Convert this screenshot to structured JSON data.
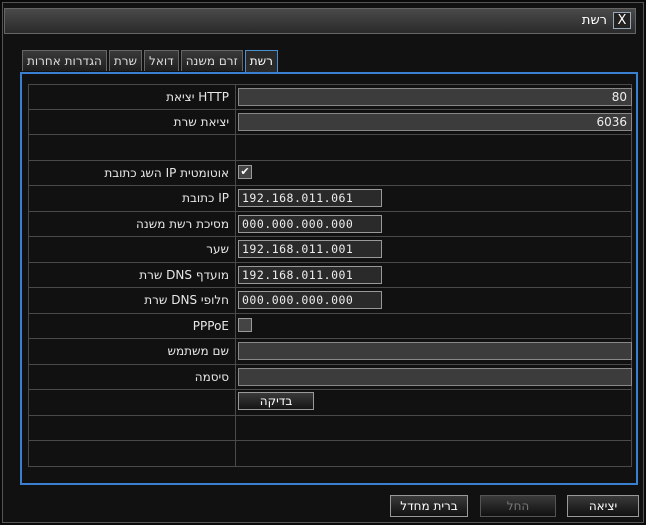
{
  "window": {
    "title": "רשת",
    "close_label": "X"
  },
  "tabs": [
    {
      "label": "רשת",
      "active": true
    },
    {
      "label": "זרם משנה"
    },
    {
      "label": "דואל"
    },
    {
      "label": "שרת"
    },
    {
      "label": "הגדרות אחרות"
    }
  ],
  "form": {
    "http_port_label": "יציאת HTTP",
    "http_port_value": "80",
    "server_port_label": "יציאת שרת",
    "server_port_value": "6036",
    "auto_ip_label": "השג כתובת IP אוטומטית",
    "auto_ip_checked": true,
    "ip_label": "כתובת IP",
    "ip_value": "192.168.011.061",
    "subnet_label": "מסיכת רשת משנה",
    "subnet_value": "000.000.000.000",
    "gateway_label": "שער",
    "gateway_value": "192.168.011.001",
    "dns1_label": "שרת DNS מועדף",
    "dns1_value": "192.168.011.001",
    "dns2_label": "שרת DNS חלופי",
    "dns2_value": "000.000.000.000",
    "pppoe_label": "PPPoE",
    "pppoe_checked": false,
    "username_label": "שם משתמש",
    "username_value": "",
    "password_label": "סיסמה",
    "password_value": "",
    "test_button": "בדיקה"
  },
  "footer": {
    "default_button": "ברית מחדל",
    "apply_button": "החל",
    "exit_button": "יציאה"
  }
}
